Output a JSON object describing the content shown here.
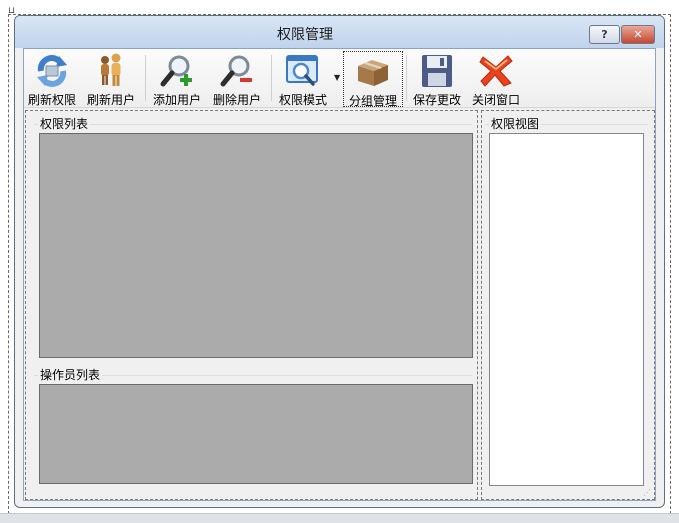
{
  "window": {
    "title": "权限管理",
    "help_glyph": "?",
    "close_glyph": "✕"
  },
  "toolbar": {
    "buttons": [
      {
        "label": "刷新权限",
        "icon": "refresh-icon"
      },
      {
        "label": "刷新用户",
        "icon": "users-icon"
      },
      {
        "label": "添加用户",
        "icon": "magnifier-plus-icon"
      },
      {
        "label": "删除用户",
        "icon": "magnifier-minus-icon"
      },
      {
        "label": "权限模式",
        "icon": "browser-search-icon",
        "has_dropdown": true
      },
      {
        "label": "分组管理",
        "icon": "box-icon",
        "selected": true
      },
      {
        "label": "保存更改",
        "icon": "floppy-disk-icon"
      },
      {
        "label": "关闭窗口",
        "icon": "close-x-icon"
      }
    ]
  },
  "left_panel": {
    "permission_list_title": "权限列表",
    "operator_list_title": "操作员列表"
  },
  "right_panel": {
    "permission_view_title": "权限视图"
  },
  "colors": {
    "grid_background": "#ababab",
    "window_border": "#5d6f86",
    "title_gradient_top": "#d9e6f5",
    "title_gradient_bottom": "#bfd3ec"
  }
}
